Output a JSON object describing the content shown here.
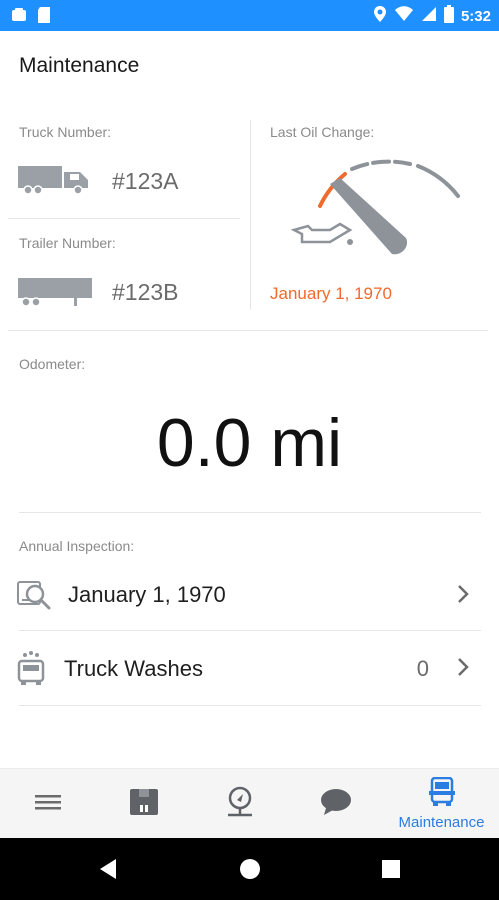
{
  "status_bar": {
    "time": "5:32",
    "bg_color": "#1e90ff"
  },
  "header": {
    "title": "Maintenance"
  },
  "truck": {
    "label": "Truck Number:",
    "number": "#123A",
    "icon": "truck-icon"
  },
  "trailer": {
    "label": "Trailer Number:",
    "number": "#123B",
    "icon": "trailer-icon"
  },
  "oil_change": {
    "label": "Last Oil Change:",
    "date": "January 1, 1970",
    "icon": "oil-gauge-icon",
    "accent_color": "#ef6a2c"
  },
  "odometer": {
    "label": "Odometer:",
    "value": "0.0 mi"
  },
  "annual_inspection": {
    "label": "Annual Inspection:",
    "date": "January 1, 1970",
    "icon": "inspection-icon"
  },
  "truck_washes": {
    "label": "Truck Washes",
    "count": "0",
    "icon": "truck-wash-icon"
  },
  "bottom_nav": {
    "items": [
      {
        "name": "menu",
        "icon": "menu-icon",
        "label": ""
      },
      {
        "name": "loads",
        "icon": "package-icon",
        "label": ""
      },
      {
        "name": "locations",
        "icon": "location-icon",
        "label": ""
      },
      {
        "name": "messages",
        "icon": "chat-icon",
        "label": ""
      },
      {
        "name": "maintenance",
        "icon": "truck-front-icon",
        "label": "Maintenance",
        "active": true
      }
    ],
    "active_color": "#2a7de1"
  }
}
